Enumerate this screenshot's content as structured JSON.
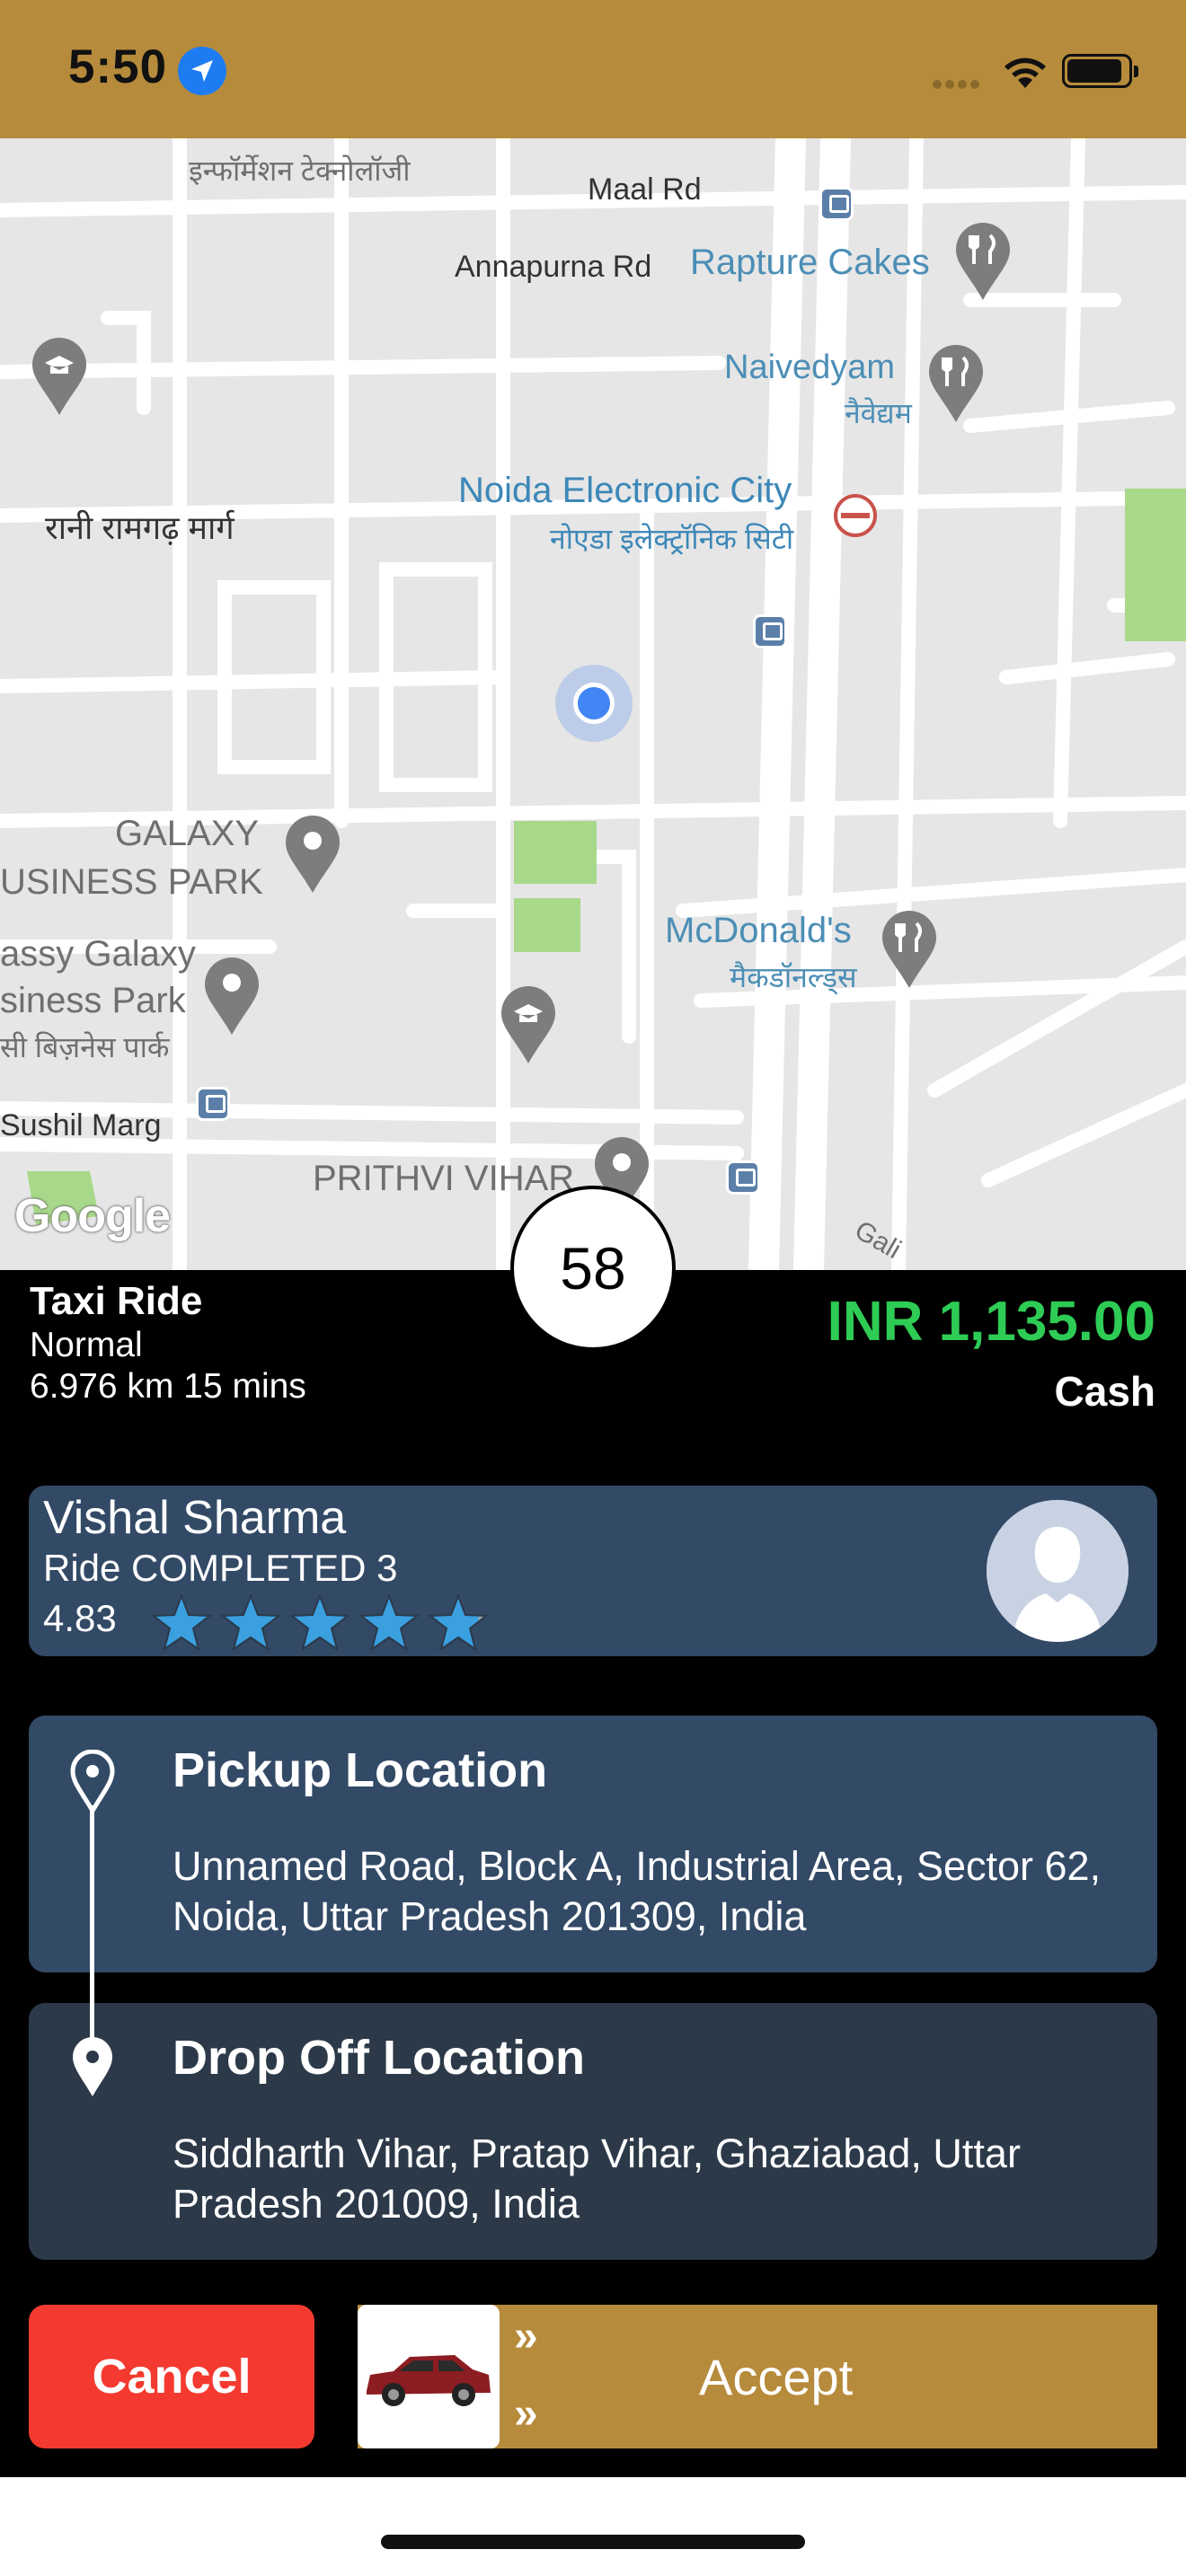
{
  "status_bar": {
    "time": "5:50",
    "icons": [
      "location-arrow-icon",
      "signal-icon",
      "wifi-icon",
      "battery-icon"
    ]
  },
  "map": {
    "labels": {
      "hindi_top": "इन्फॉर्मेशन टेक्नोलॉजी",
      "maal_rd": "Maal Rd",
      "annapurna_rd": "Annapurna Rd",
      "rapture_cakes": "Rapture Cakes",
      "naivedyam": "Naivedyam",
      "naivedyam_hi": "नैवेद्यम",
      "rani_ramgarh": "रानी रामगढ़ मार्ग",
      "noida_ec": "Noida Electronic City",
      "noida_ec_hi": "नोएडा इलेक्ट्रॉनिक सिटी",
      "galaxy_1": "GALAXY",
      "galaxy_2": "USINESS PARK",
      "mcdonalds": "McDonald's",
      "mcdonalds_hi": "मैकडॉनल्ड्स",
      "classy_1": "assy Galaxy",
      "classy_2": "siness Park",
      "classy_hi": "सी बिज़नेस पार्क",
      "sushil_marg": "Sushil Marg",
      "prithvi_vihar": "PRITHVI VIHAR",
      "gali": "Gali"
    },
    "attribution": "Google"
  },
  "timer": "58",
  "ride": {
    "type": "Taxi Ride",
    "class": "Normal",
    "distance_time": "6.976 km 15 mins",
    "fare": "INR 1,135.00",
    "payment": "Cash"
  },
  "driver": {
    "name": "Vishal Sharma",
    "rides": "Ride COMPLETED 3",
    "rating": "4.83",
    "rating_value": 4.83,
    "rating_max": 5
  },
  "pickup": {
    "title": "Pickup Location",
    "address": "Unnamed Road, Block A, Industrial Area, Sector 62, Noida, Uttar Pradesh 201309, India"
  },
  "dropoff": {
    "title": "Drop Off Location",
    "address": "Siddharth Vihar, Pratap Vihar, Ghaziabad, Uttar Pradesh 201009, India"
  },
  "actions": {
    "cancel": "Cancel",
    "accept": "Accept"
  },
  "colors": {
    "accent_gold": "#b68b3b",
    "fare_green": "#2ecc55",
    "cancel_red": "#f43a30",
    "card_blue": "#334a66",
    "card_dark": "#2c3949"
  }
}
